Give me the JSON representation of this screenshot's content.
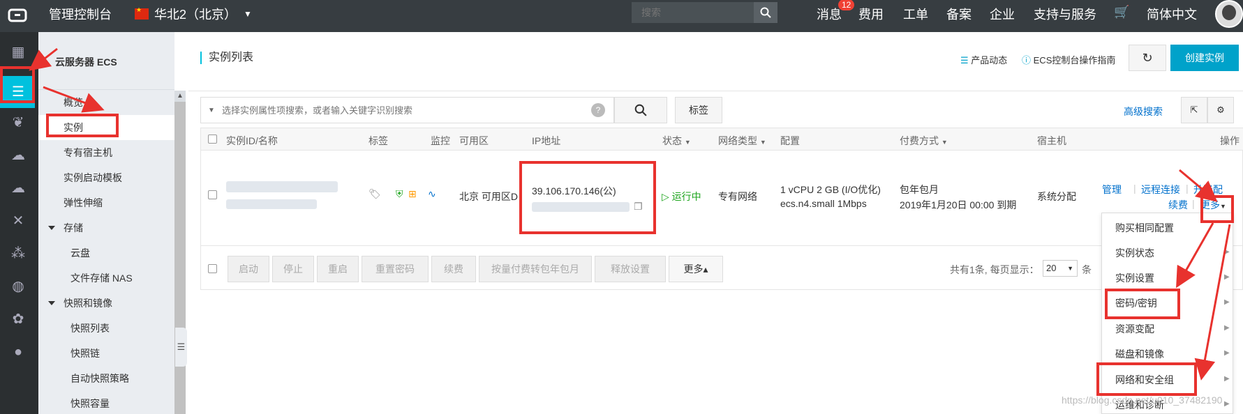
{
  "topbar": {
    "console": "管理控制台",
    "region": "华北2（北京）",
    "search_placeholder": "搜索",
    "nav": [
      "消息",
      "费用",
      "工单",
      "备案",
      "企业",
      "支持与服务",
      "简体中文"
    ],
    "message_count": "12"
  },
  "sidebar": {
    "title": "云服务器 ECS",
    "items": [
      "概览",
      "实例",
      "专有宿主机",
      "实例启动模板",
      "弹性伸缩",
      "存储",
      "云盘",
      "文件存储 NAS",
      "快照和镜像",
      "快照列表",
      "快照链",
      "自动快照策略",
      "快照容量"
    ]
  },
  "main": {
    "title": "实例列表",
    "product_news": "产品动态",
    "guide": "ECS控制台操作指南",
    "create_btn": "创建实例",
    "search_placeholder": "选择实例属性项搜索，或者输入关键字识别搜索",
    "tag_btn": "标签",
    "advanced_search": "高级搜索"
  },
  "table": {
    "headers": [
      "实例ID/名称",
      "标签",
      "监控",
      "可用区",
      "IP地址",
      "状态",
      "网络类型",
      "配置",
      "付费方式",
      "宿主机",
      "操作"
    ],
    "row": {
      "zone": "北京 可用区D",
      "ip": "39.106.170.146(公)",
      "status": "运行中",
      "network": "专有网络",
      "config_line1": "1 vCPU 2 GB (I/O优化)",
      "config_line2": "ecs.n4.small   1Mbps",
      "billing_line1": "包年包月",
      "billing_line2": "2019年1月20日 00:00 到期",
      "host": "系统分配",
      "action_manage": "管理",
      "action_remote": "远程连接",
      "action_upgrade": "升降配",
      "action_renew": "续费",
      "action_more": "更多"
    },
    "footer_buttons": [
      "启动",
      "停止",
      "重启",
      "重置密码",
      "续费",
      "按量付费转包年包月",
      "释放设置",
      "更多▴"
    ],
    "pagination": "共有1条, 每页显示：",
    "page_size": "20",
    "page_unit": "条"
  },
  "menu": {
    "items": [
      "购买相同配置",
      "实例状态",
      "实例设置",
      "密码/密钥",
      "资源变配",
      "磁盘和镜像",
      "网络和安全组",
      "运维和诊断"
    ]
  },
  "watermark": "https://blog.csdn.net/u010_37482190",
  "colors": {
    "accent": "#00c1de",
    "primary_btn": "#00a2ca",
    "annotation": "#e8322e",
    "topbar": "#373d41"
  }
}
